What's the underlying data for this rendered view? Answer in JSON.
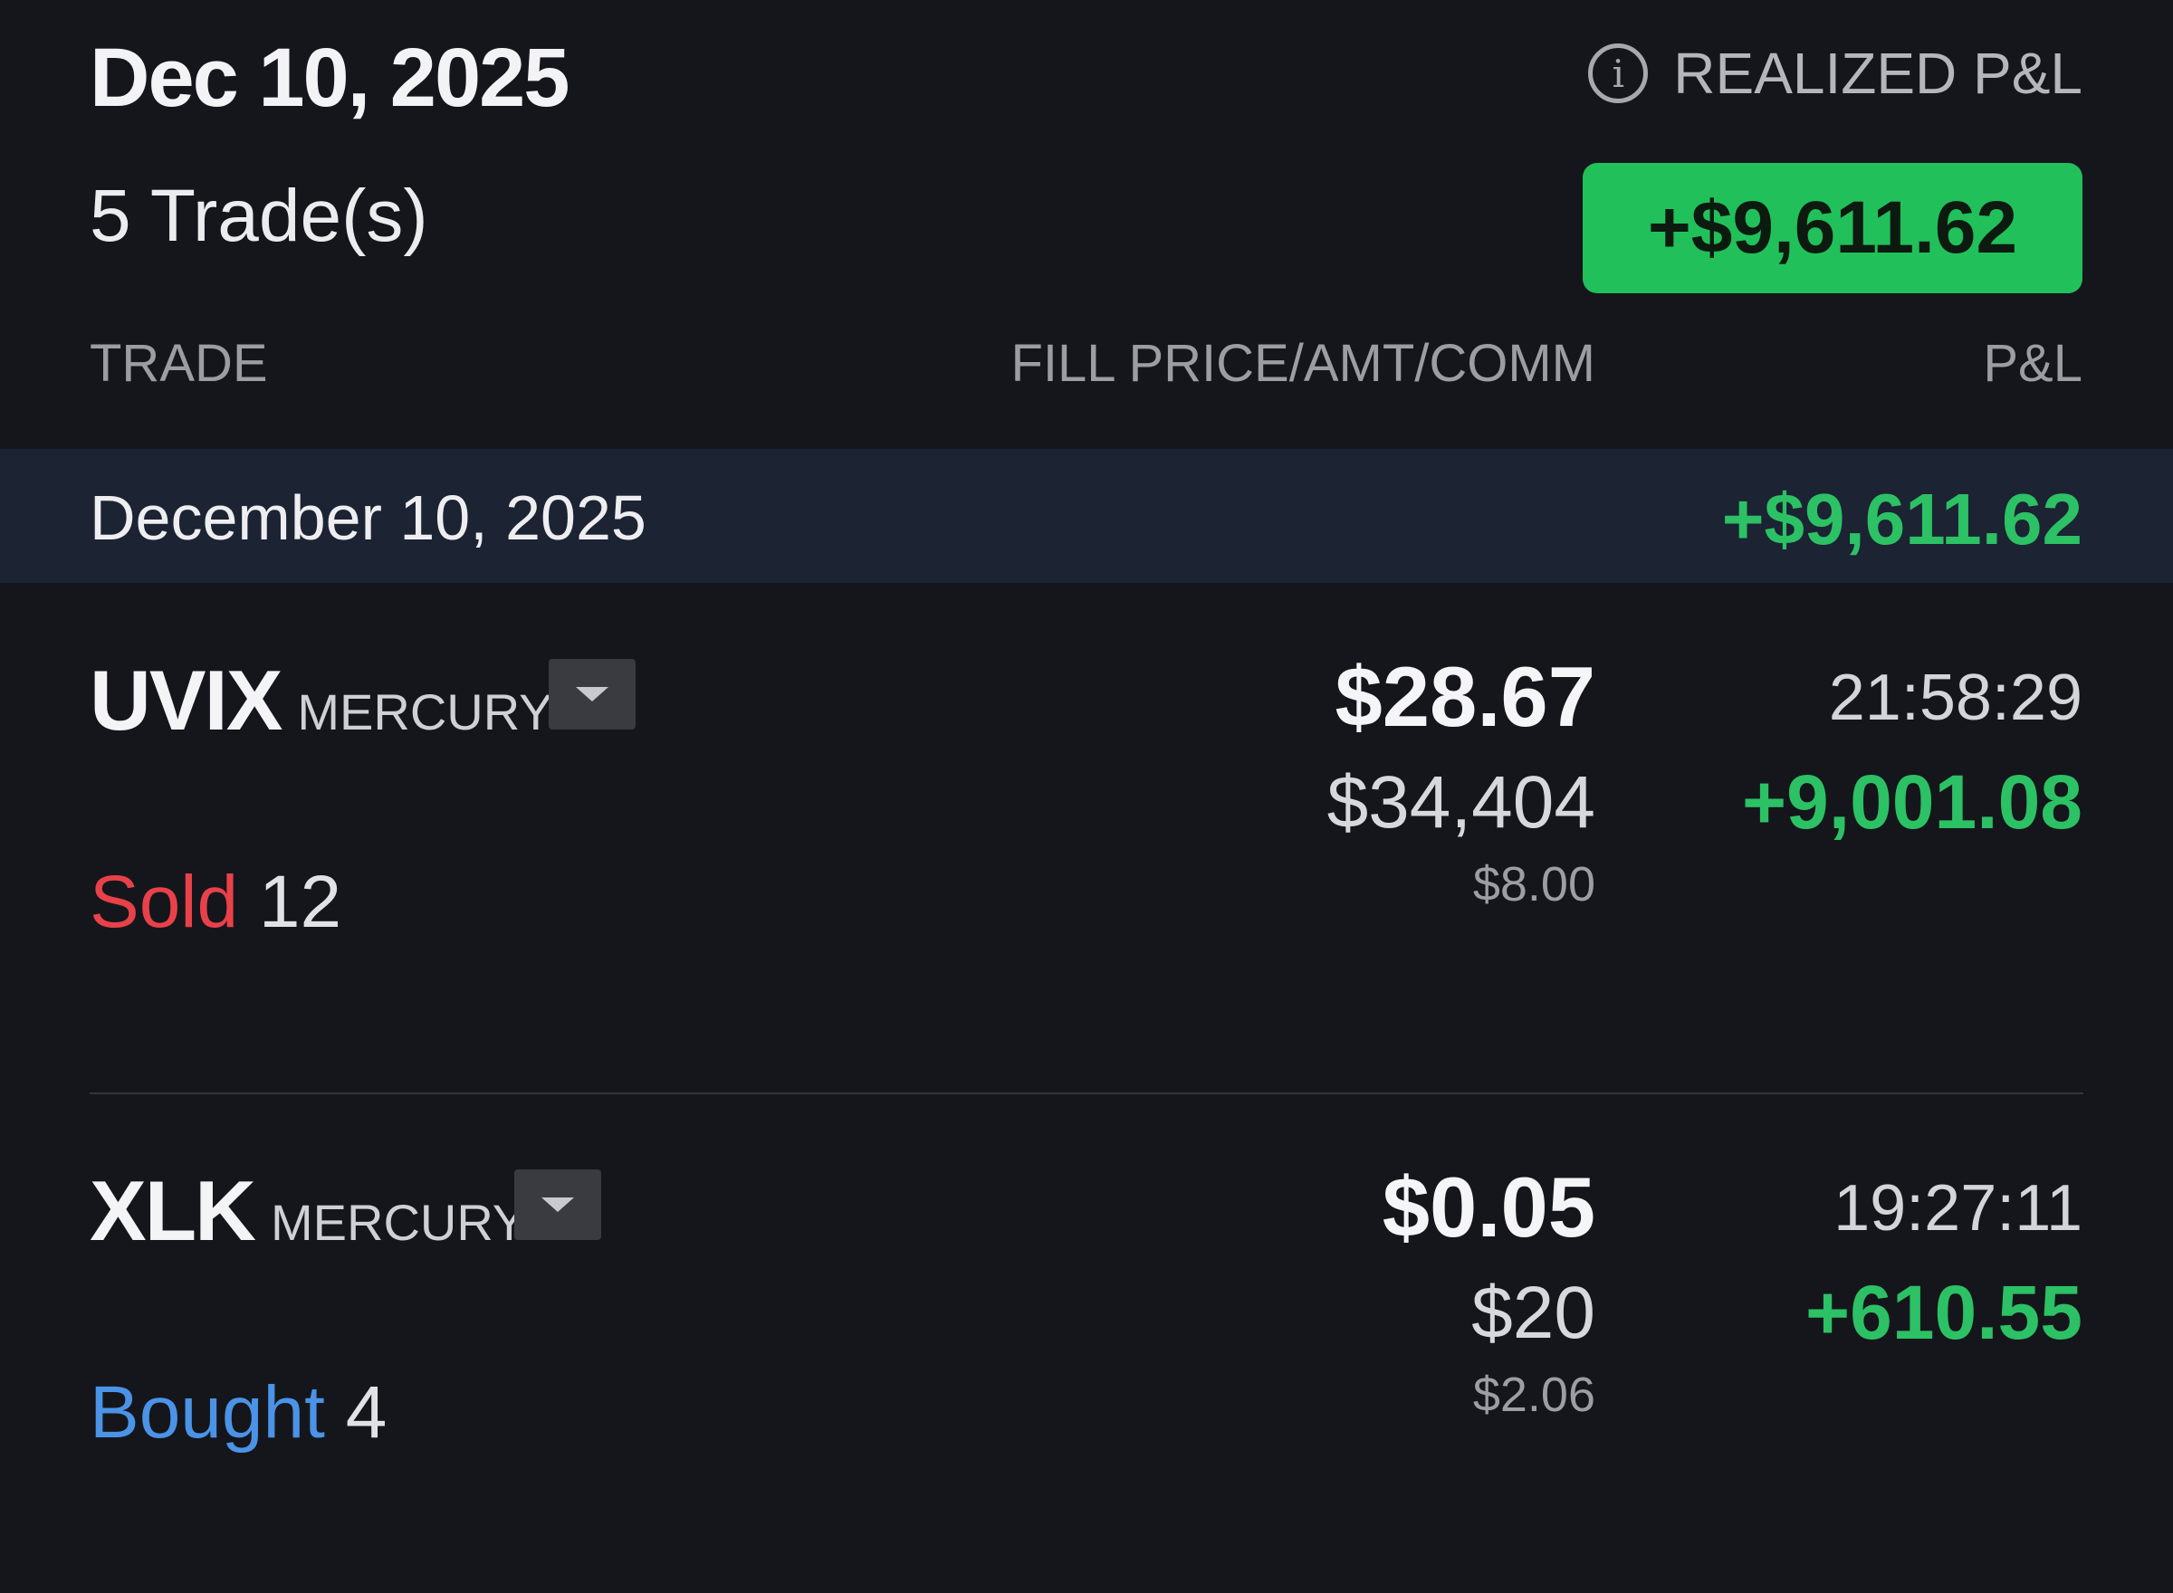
{
  "header": {
    "date_title": "Dec 10, 2025",
    "trade_count": "5 Trade(s)",
    "realized_label": "REALIZED P&L",
    "realized_value": "+$9,611.62",
    "info_icon": "info-circle-icon"
  },
  "columns": {
    "trade": "TRADE",
    "fill": "FILL PRICE/AMT/COMM",
    "pnl": "P&L"
  },
  "group": {
    "date": "December 10, 2025",
    "pnl": "+$9,611.62"
  },
  "trades": [
    {
      "symbol": "UVIX",
      "exchange": "MERCURY",
      "action": "Sold",
      "quantity": "12",
      "fill_price": "$28.67",
      "amount": "$34,404",
      "commission": "$8.00",
      "time": "21:58:29",
      "pnl": "+9,001.08"
    },
    {
      "symbol": "XLK",
      "exchange": "MERCURY",
      "action": "Bought",
      "quantity": "4",
      "fill_price": "$0.05",
      "amount": "$20",
      "commission": "$2.06",
      "time": "19:27:11",
      "pnl": "+610.55"
    }
  ],
  "colors": {
    "background": "#15161b",
    "band": "#1c2333",
    "profit_green": "#2cc165",
    "badge_green": "#21c05b",
    "sold_red": "#e8414a",
    "bought_blue": "#4a93e6"
  }
}
